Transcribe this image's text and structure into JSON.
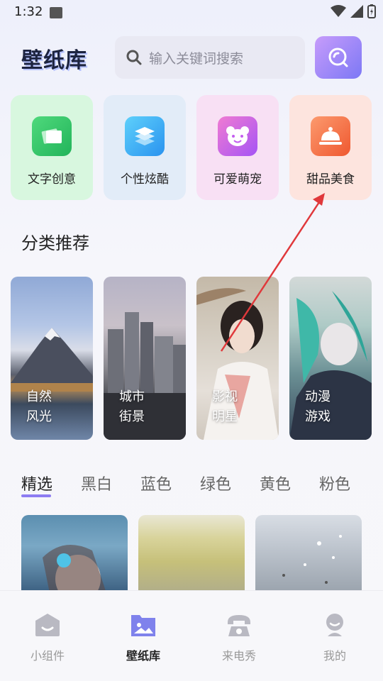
{
  "status_bar": {
    "time": "1:32"
  },
  "header": {
    "logo": "壁纸库",
    "search_placeholder": "输入关键词搜索"
  },
  "categories": [
    {
      "label": "文字创意",
      "icon": "text-cards-icon",
      "bg": "#d8f7df",
      "icon_color": "#2cc565"
    },
    {
      "label": "个性炫酷",
      "icon": "layers-icon",
      "bg": "#e2ecf8",
      "icon_color": "#36a9f3"
    },
    {
      "label": "可爱萌宠",
      "icon": "bear-icon",
      "bg": "#f8e0f4",
      "icon_color": "#c45ef0"
    },
    {
      "label": "甜品美食",
      "icon": "food-cloche-icon",
      "bg": "#fde4de",
      "icon_color": "#f2653b"
    }
  ],
  "section_title": "分类推荐",
  "photo_categories": [
    {
      "line1": "自然",
      "line2": "风光"
    },
    {
      "line1": "城市",
      "line2": "街景"
    },
    {
      "line1": "影视",
      "line2": "明星"
    },
    {
      "line1": "动漫",
      "line2": "游戏"
    }
  ],
  "color_tabs": [
    "精选",
    "黑白",
    "蓝色",
    "绿色",
    "黄色",
    "粉色"
  ],
  "active_color_tab": "精选",
  "bottom_nav": [
    {
      "label": "小组件",
      "icon": "widget-face-icon",
      "active": false
    },
    {
      "label": "壁纸库",
      "icon": "wallpaper-folder-icon",
      "active": true
    },
    {
      "label": "来电秀",
      "icon": "telephone-icon",
      "active": false
    },
    {
      "label": "我的",
      "icon": "profile-icon",
      "active": false
    }
  ],
  "colors": {
    "accent": "#8d7cf2",
    "annotation_arrow": "#e0383b"
  }
}
